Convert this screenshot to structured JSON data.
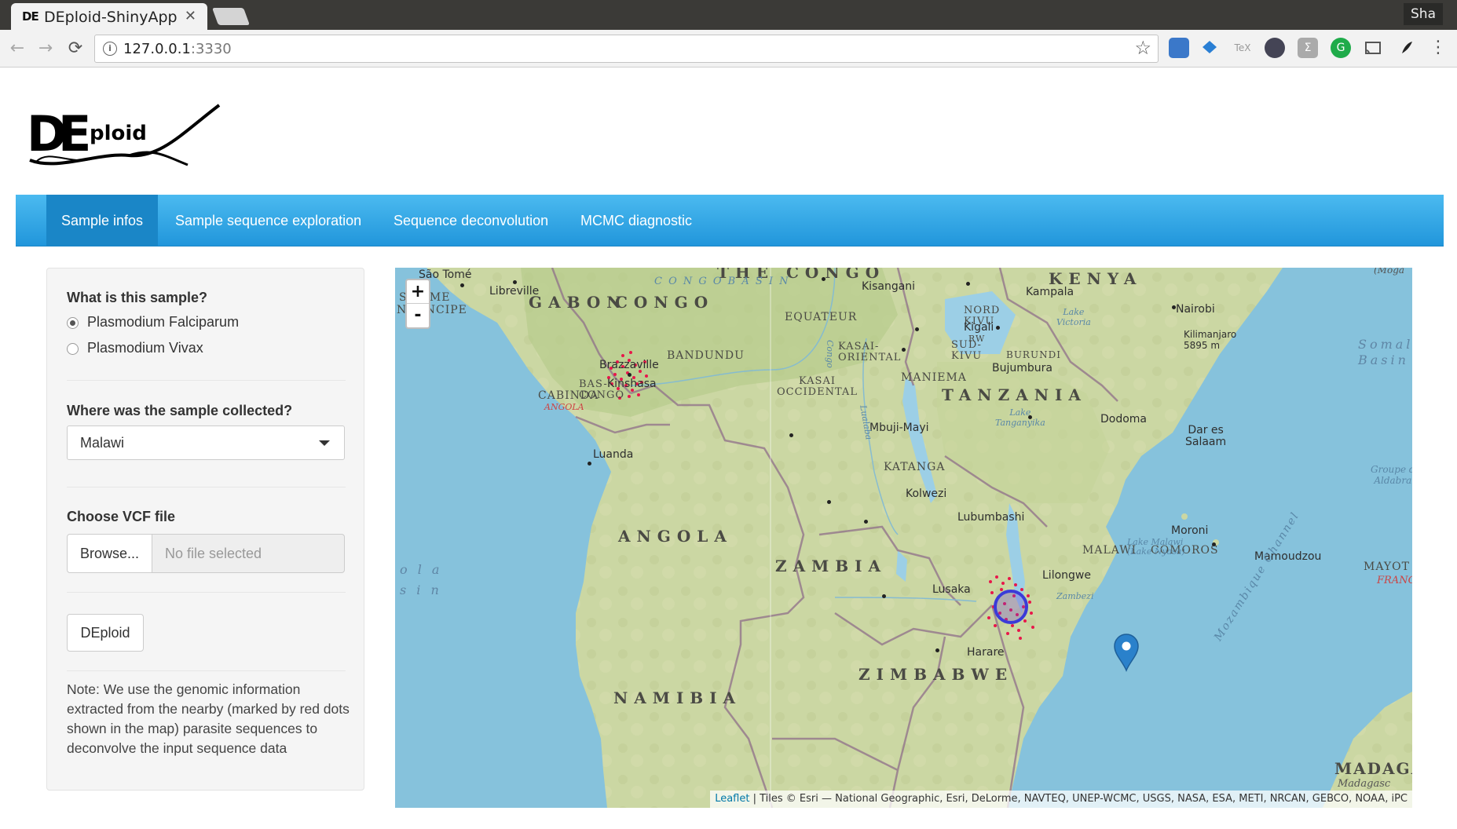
{
  "browser": {
    "tab_title": "DEploid-ShinyApp",
    "tab_favicon_text": "DE",
    "tab_close": "✕",
    "user_chip": "Sha",
    "nav_back": "←",
    "nav_forward": "→",
    "nav_reload": "⟳",
    "address_info": "i",
    "url_host": "127.0.0.1",
    "url_port": ":3330",
    "bookmark_icon": "☆"
  },
  "app": {
    "logo_text": "DEploid",
    "tabs": [
      {
        "label": "Sample infos",
        "active": true
      },
      {
        "label": "Sample sequence exploration",
        "active": false
      },
      {
        "label": "Sequence deconvolution",
        "active": false
      },
      {
        "label": "MCMC diagnostic",
        "active": false
      }
    ],
    "sidebar": {
      "species_label": "What is this sample?",
      "species_options": [
        {
          "label": "Plasmodium Falciparum",
          "checked": true
        },
        {
          "label": "Plasmodium Vivax",
          "checked": false
        }
      ],
      "location_label": "Where was the sample collected?",
      "location_value": "Malawi",
      "vcf_label": "Choose VCF file",
      "browse_label": "Browse...",
      "file_placeholder": "No file selected",
      "run_label": "DEploid",
      "note": "Note: We use the genomic information extracted from the nearby (marked by red dots shown in the map) parasite sequences to deconvolve the input sequence data"
    },
    "map": {
      "zoom_in": "+",
      "zoom_out": "-",
      "attribution_link": "Leaflet",
      "attribution_text": " | Tiles © Esri — National Geographic, Esri, DeLorme, NAVTEQ, UNEP-WCMC, USGS, NASA, ESA, METI, NRCAN, GEBCO, NOAA, iPC",
      "marker_location": "Malawi",
      "labels": {
        "gabon": "GABON",
        "congo": "CONGO",
        "the_congo": "THE CONGO",
        "congo_basin": "C O N G O   B A S I N",
        "kenya": "KENYA",
        "tanzania": "TANZANIA",
        "angola": "ANGOLA",
        "zambia": "ZAMBIA",
        "zimbabwe": "ZIMBABWE",
        "namibia": "NAMIBIA",
        "malawi": "MALAWI",
        "comoros": "COMOROS",
        "mayotte": "MAYOT",
        "france": "FRANC",
        "madagascar": "MADAGA",
        "madagasc": "Madagasc",
        "sao_tome": "São Tomé",
        "s_tome": "S  TOME",
        "principe": "N  RINCIPE",
        "libreville": "Libreville",
        "brazzaville": "Brazzaville",
        "kinshasa": "Kinshasa",
        "bas_congo": "BAS-\nCONGO",
        "cabinda": "CABINDA",
        "cabinda_angola": "ANGOLA",
        "luanda": "Luanda",
        "bandundu": "BANDUNDU",
        "equateur": "EQUATEUR",
        "kisangani": "Kisangani",
        "kasai_oriental": "KASAI-\nORIENTAL",
        "kasai_occidental": "KASAI\nOCCIDENTAL",
        "mbuji_mayi": "Mbuji-Mayi",
        "maniema": "MANIEMA",
        "nord_kivu": "NORD\nKIVU",
        "sud_kivu": "SUD-\nKIVU",
        "kigali": "Kigali",
        "rw": "RW",
        "burundi": "BURUNDI",
        "bujumbura": "Bujumbura",
        "kampala": "Kampala",
        "lake_victoria": "Lake\nVictoria",
        "nairobi": "Nairobi",
        "kilimanjaro": "Kilimanjaro\n5895 m",
        "somali_basin": "Somal\nBasin",
        "lake_tanganyika": "Lake\nTanganyika",
        "dodoma": "Dodoma",
        "dar_es_salaam": "Dar es\nSalaam",
        "katanga": "KATANGA",
        "kolwezi": "Kolwezi",
        "lubumbashi": "Lubumbashi",
        "lake_malawi": "Lake Malawi\n(Lake Nyasa)",
        "lilongwe": "Lilongwe",
        "lusaka": "Lusaka",
        "zambezi": "Zambezi",
        "harare": "Harare",
        "moroni": "Moroni",
        "mamoudzou": "Mamoudzou",
        "groupe_aldabra": "Groupe d\nAldabra",
        "mozambique_channel": "Mozambique Channel",
        "mogad": "(Moga",
        "ola_sin": "o l a\ns i n",
        "congo_river": "Congo",
        "lualaba": "Lualaba"
      }
    }
  }
}
